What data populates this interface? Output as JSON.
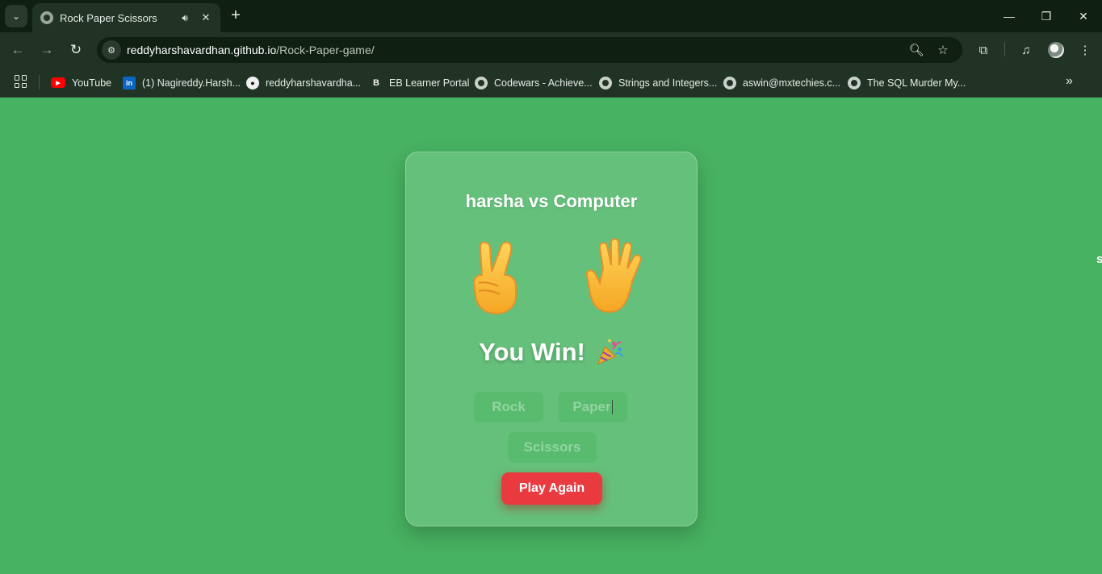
{
  "browser": {
    "tab_title": "Rock Paper Scissors",
    "url_host": "reddyharshavardhan.github.io",
    "url_path": "/Rock-Paper-game/",
    "bookmarks": [
      {
        "label": "YouTube",
        "icon": "youtube-icon"
      },
      {
        "label": "(1) Nagireddy.Harsh...",
        "icon": "linkedin-icon"
      },
      {
        "label": "reddyharshavardha...",
        "icon": "github-icon"
      },
      {
        "label": "EB Learner Portal",
        "icon": "eb-icon"
      },
      {
        "label": "Codewars - Achieve...",
        "icon": "globe-icon"
      },
      {
        "label": "Strings and Integers...",
        "icon": "globe-icon"
      },
      {
        "label": "aswin@mxtechies.c...",
        "icon": "globe-icon"
      },
      {
        "label": "The SQL Murder My...",
        "icon": "globe-icon"
      }
    ]
  },
  "page": {
    "edge_text": "s"
  },
  "game": {
    "heading": "harsha vs Computer",
    "player_choice_icon": "victory-hand-icon",
    "computer_choice_icon": "raised-hand-icon",
    "result": "You Win!",
    "result_icon": "party-popper-icon",
    "buttons": {
      "rock": "Rock",
      "paper": "Paper",
      "scissors": "Scissors",
      "play_again": "Play Again"
    }
  },
  "colors": {
    "page_background": "#47b261",
    "card_background": "#65c07b",
    "play_again_button": "#e93b3f"
  }
}
